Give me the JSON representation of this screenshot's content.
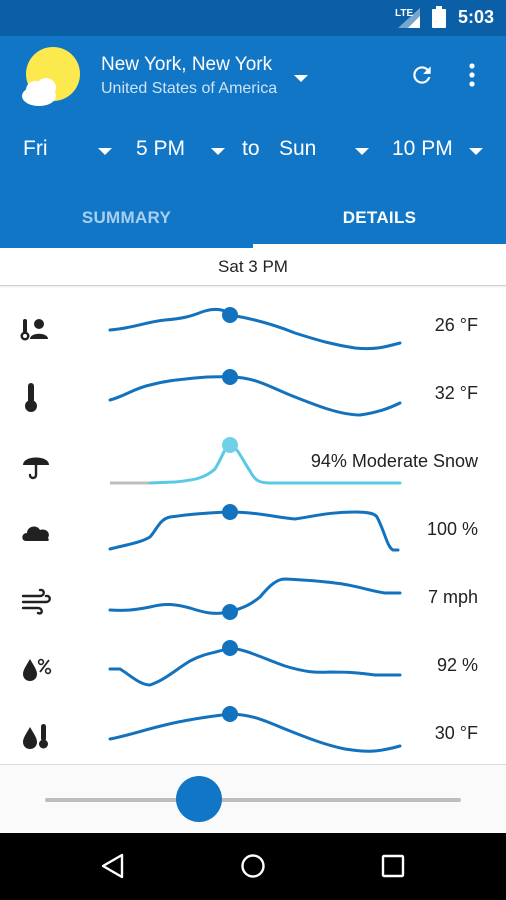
{
  "status_bar": {
    "network": "LTE",
    "time": "5:03"
  },
  "header": {
    "location_name": "New York, New York",
    "location_country": "United States of America",
    "range": {
      "from_day": "Fri",
      "from_time": "5 PM",
      "connector": "to",
      "to_day": "Sun",
      "to_time": "10 PM"
    },
    "tabs": [
      {
        "label": "SUMMARY",
        "selected": false
      },
      {
        "label": "DETAILS",
        "selected": true
      }
    ]
  },
  "selected_time": "Sat 3 PM",
  "metrics": [
    {
      "name": "feels-like",
      "icon": "feels-like-icon",
      "value": "26 °F"
    },
    {
      "name": "temperature",
      "icon": "thermometer-icon",
      "value": "32 °F"
    },
    {
      "name": "precipitation",
      "icon": "umbrella-icon",
      "value": "94% Moderate Snow"
    },
    {
      "name": "cloud-cover",
      "icon": "cloud-icon",
      "value": "100 %"
    },
    {
      "name": "wind",
      "icon": "wind-icon",
      "value": "7 mph"
    },
    {
      "name": "humidity",
      "icon": "humidity-icon",
      "value": "92 %"
    },
    {
      "name": "dew-point",
      "icon": "dew-point-icon",
      "value": "30 °F"
    }
  ],
  "slider": {
    "position": 0.37
  },
  "colors": {
    "status_bar": "#0A5FA6",
    "header": "#1176C6",
    "line": "#1272BE",
    "precip_line": "#5BC8E6",
    "precip_dot": "#6FD0EA",
    "icon": "#212121"
  }
}
